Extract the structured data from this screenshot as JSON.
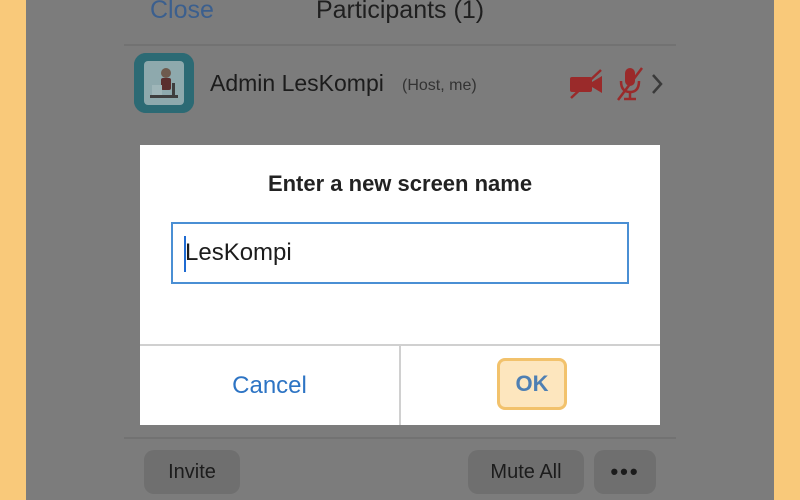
{
  "header": {
    "close_label": "Close",
    "title": "Participants (1)"
  },
  "participant": {
    "name": "Admin LesKompi",
    "tag": "(Host, me)",
    "icons": [
      "camera-off-icon",
      "mic-off-icon",
      "chevron-right-icon"
    ]
  },
  "dialog": {
    "title": "Enter a new screen name",
    "input_value": "LesKompi",
    "cancel_label": "Cancel",
    "ok_label": "OK"
  },
  "bottom_bar": {
    "invite_label": "Invite",
    "mute_all_label": "Mute All",
    "more_label": "•••"
  },
  "colors": {
    "frame_border": "#f9c97a",
    "overlay": "#7c7c7c",
    "accent_blue": "#2d74c4",
    "muted_red": "#9a2a2a",
    "ok_highlight": "#fde6be"
  }
}
